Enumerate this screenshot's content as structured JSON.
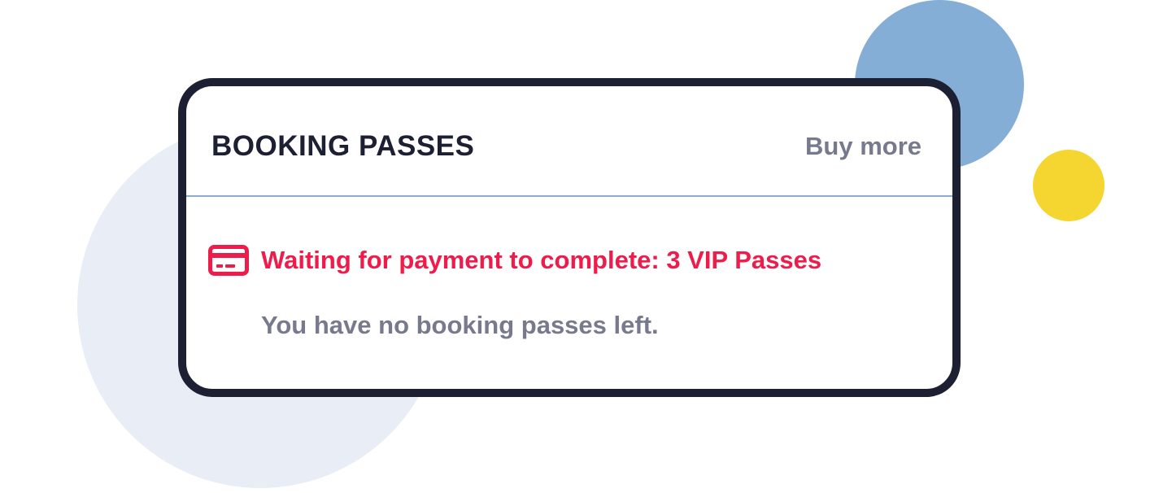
{
  "card": {
    "title": "BOOKING PASSES",
    "buy_more_label": "Buy more"
  },
  "payment_status": {
    "icon": "credit-card-icon",
    "text": "Waiting for payment to complete: 3 VIP Passes"
  },
  "empty_message": "You have no booking passes left.",
  "colors": {
    "card_border": "#1d1f33",
    "alert": "#ee1c4a",
    "muted_text": "#767a8c",
    "divider": "#8cabd2",
    "deco_pale": "#e9edf5",
    "deco_blue": "#85aed6",
    "deco_yellow": "#f5d530"
  }
}
